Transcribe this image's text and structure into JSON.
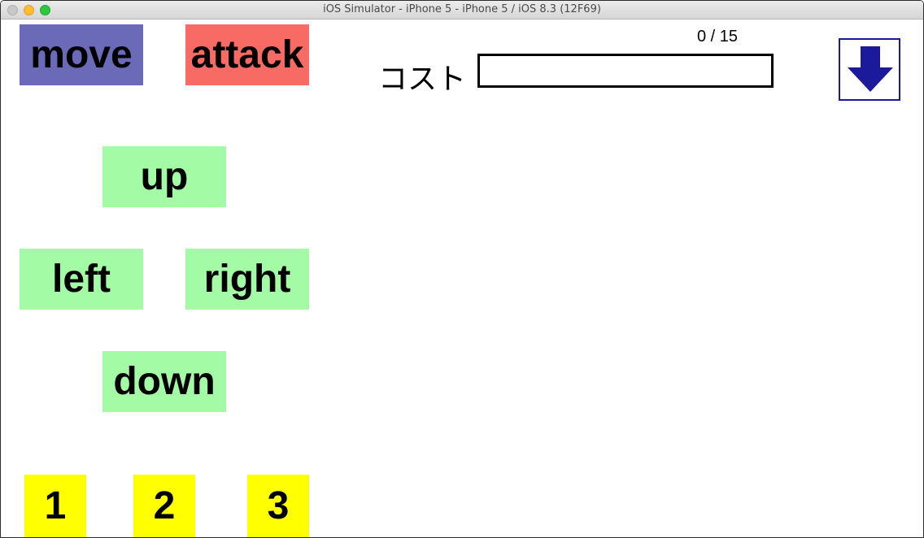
{
  "window": {
    "title": "iOS Simulator - iPhone 5 - iPhone 5 / iOS 8.3 (12F69)"
  },
  "controls": {
    "move_label": "move",
    "attack_label": "attack",
    "up_label": "up",
    "left_label": "left",
    "right_label": "right",
    "down_label": "down"
  },
  "slots": [
    "1",
    "2",
    "3"
  ],
  "cost": {
    "label": "コスト",
    "current": 0,
    "max": 15,
    "display": "0 / 15",
    "fill_fraction": 0
  },
  "icons": {
    "submit": "down-arrow-icon"
  },
  "colors": {
    "move": "#6b6ab8",
    "attack": "#f76b64",
    "direction": "#a4fba6",
    "slot": "#ffff00",
    "arrow": "#1a1a9a"
  }
}
